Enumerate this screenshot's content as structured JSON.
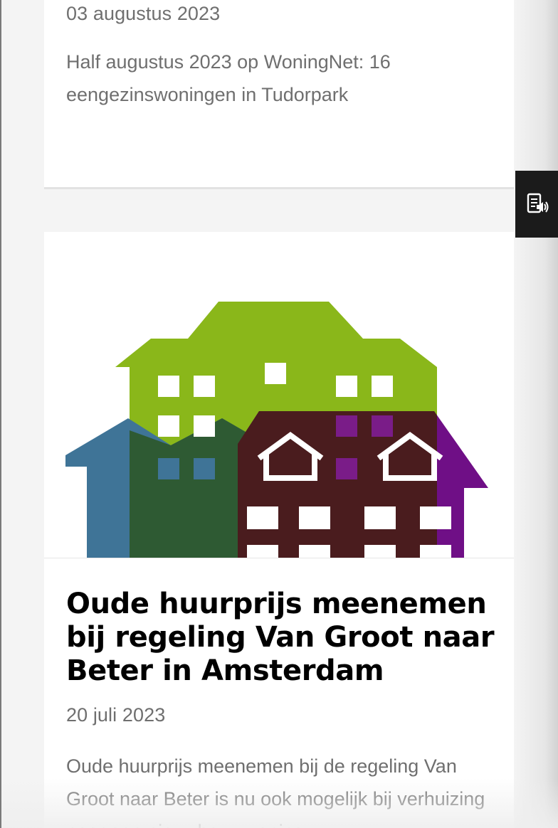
{
  "articles": [
    {
      "date": "03 augustus 2023",
      "excerpt": "Half augustus 2023 op WoningNet: 16 eengezinswoningen in Tudorpark"
    },
    {
      "image_icon": "houses-illustration-icon",
      "title": "Oude huurprijs meenemen bij regeling Van Groot naar Beter in Amsterdam",
      "date": "20 juli 2023",
      "excerpt": "Oude huurprijs meenemen bij de regeling Van Groot naar Beter is nu ook mogelijk bij verhuizing naar een nieuwbouwwoning"
    }
  ],
  "readspeaker": {
    "icon": "read-aloud-icon"
  },
  "colors": {
    "green": "#8ab71a",
    "blue": "#3f7497",
    "purple": "#6f0f86",
    "dark_overlap": "#4a1c1e",
    "teal_overlap": "#2e5a33"
  }
}
